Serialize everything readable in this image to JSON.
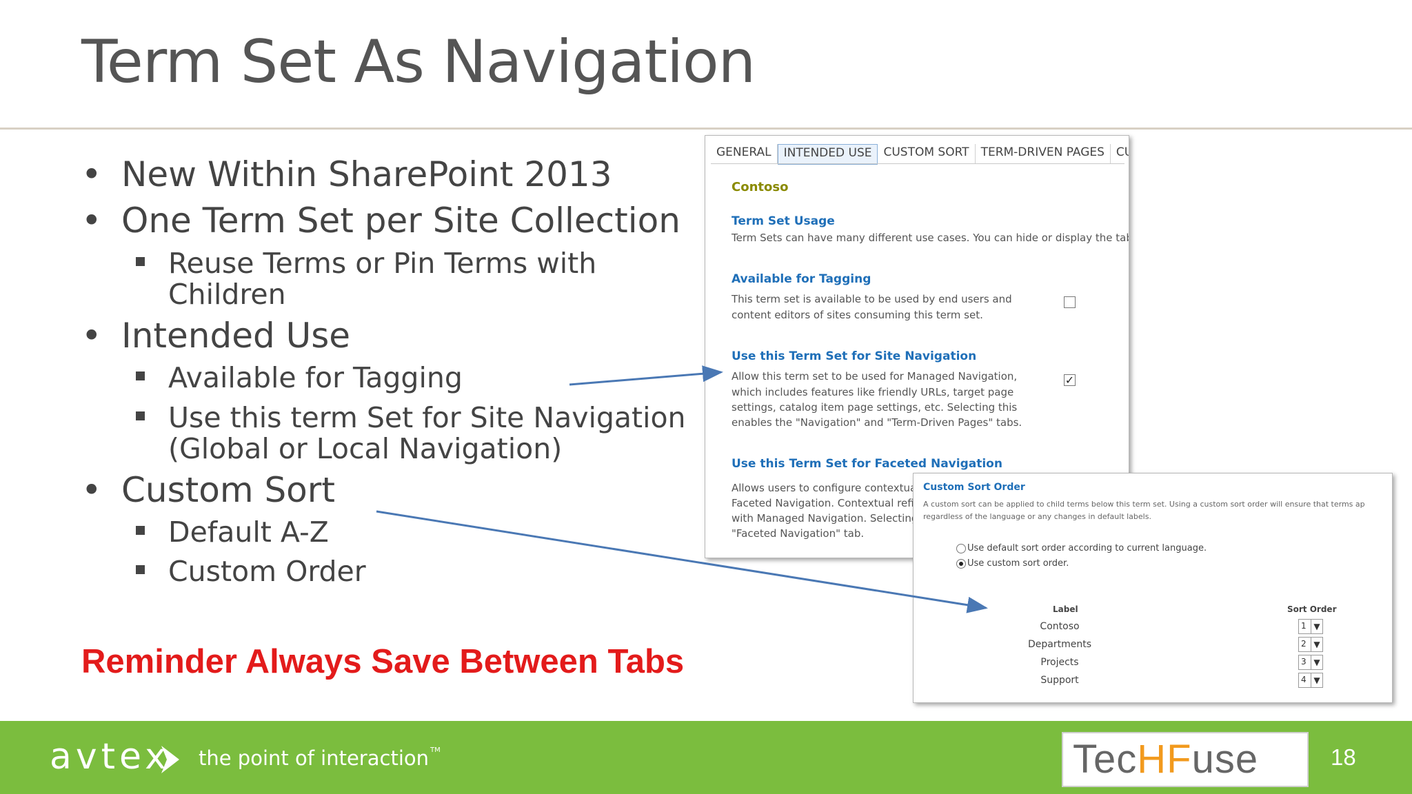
{
  "slide": {
    "title": "Term Set As Navigation",
    "page_number": "18",
    "reminder": "Reminder Always Save Between Tabs"
  },
  "bullets": [
    {
      "text": "New Within SharePoint 2013"
    },
    {
      "text": "One Term Set per Site Collection",
      "sub": [
        "Reuse Terms or Pin Terms with",
        "Children"
      ]
    },
    {
      "text": "Intended Use",
      "sub": [
        "Available for Tagging",
        "Use this term Set for Site Navigation",
        "(Global or Local Navigation)"
      ]
    },
    {
      "text": "Custom Sort",
      "sub": [
        "Default A-Z",
        "Custom Order"
      ]
    }
  ],
  "panel1": {
    "tabs": [
      "GENERAL",
      "INTENDED USE",
      "CUSTOM SORT",
      "TERM-DRIVEN PAGES",
      "CUS"
    ],
    "active_tab": "INTENDED USE",
    "heading": "Contoso",
    "term_set_usage": {
      "title": "Term Set Usage",
      "text": "Term Sets can have many different use cases. You can hide or display the tabs"
    },
    "tagging": {
      "title": "Available for Tagging",
      "lines": [
        "This term set is available to be used by end users and",
        "content editors of sites consuming this term set."
      ],
      "checked": false
    },
    "site_nav": {
      "title": "Use this Term Set for Site Navigation",
      "lines": [
        "Allow this term set to be used for Managed Navigation,",
        "which includes features like friendly URLs, target page",
        "settings, catalog item page settings, etc. Selecting this",
        "enables the \"Navigation\" and \"Term-Driven Pages\" tabs."
      ],
      "checked": true
    },
    "faceted_nav": {
      "title": "Use this Term Set for Faceted Navigation",
      "lines": [
        "Allows users to configure contextua",
        "Faceted Navigation. Contextual refi",
        "with Managed Navigation. Selecting",
        "\"Faceted Navigation\" tab."
      ]
    }
  },
  "panel2": {
    "title": "Custom Sort Order",
    "desc_lines": [
      "A custom sort can be applied to child terms below this term set. Using a custom sort order will ensure that terms ap",
      "regardless of the language or any changes in default labels."
    ],
    "radio_default": "Use default sort order according to current language.",
    "radio_custom": "Use custom sort order.",
    "col_label": "Label",
    "col_sort": "Sort Order",
    "rows": [
      {
        "label": "Contoso",
        "order": "1"
      },
      {
        "label": "Departments",
        "order": "2"
      },
      {
        "label": "Projects",
        "order": "3"
      },
      {
        "label": "Support",
        "order": "4"
      }
    ]
  },
  "footer": {
    "logo": "avtex",
    "tagline": "the point of interaction",
    "tm": "TM",
    "techfuse_prefix": "Tec",
    "techfuse_mid": "HF",
    "techfuse_suffix": "use"
  },
  "colors": {
    "footer_green": "#7bbd3e",
    "reminder_red": "#e31b1b",
    "link_blue": "#1f6fb8",
    "arrow_blue": "#4a78b4"
  }
}
